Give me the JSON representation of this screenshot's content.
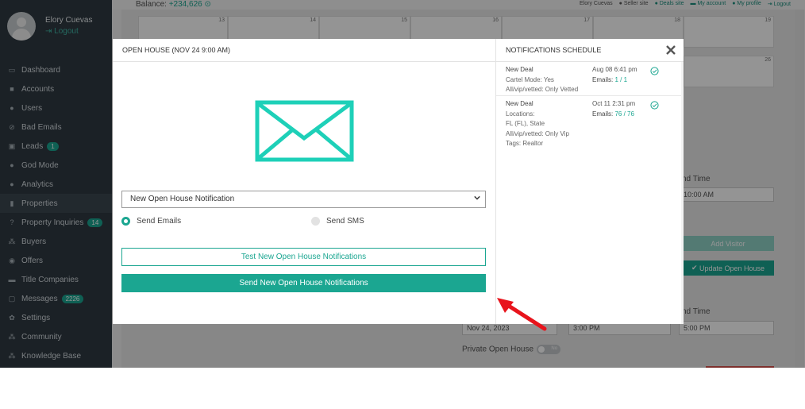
{
  "user": {
    "name": "Elory Cuevas",
    "logout": "Logout"
  },
  "sidebar": {
    "items": [
      {
        "label": "Dashboard",
        "icon": "dashboard-icon",
        "glyph": "▭"
      },
      {
        "label": "Accounts",
        "icon": "briefcase-icon",
        "glyph": "■"
      },
      {
        "label": "Users",
        "icon": "user-icon",
        "glyph": "●"
      },
      {
        "label": "Bad Emails",
        "icon": "ban-icon",
        "glyph": "⊘"
      },
      {
        "label": "Leads",
        "icon": "leads-icon",
        "glyph": "▣",
        "badge": "1"
      },
      {
        "label": "God Mode",
        "icon": "globe-icon",
        "glyph": "●"
      },
      {
        "label": "Analytics",
        "icon": "globe-icon",
        "glyph": "●"
      },
      {
        "label": "Properties",
        "icon": "building-icon",
        "glyph": "▮",
        "active": true
      },
      {
        "label": "Property Inquiries",
        "icon": "question-icon",
        "glyph": "?",
        "badge": "14"
      },
      {
        "label": "Buyers",
        "icon": "buyers-icon",
        "glyph": "⁂"
      },
      {
        "label": "Offers",
        "icon": "offers-icon",
        "glyph": "◉"
      },
      {
        "label": "Title Companies",
        "icon": "list-icon",
        "glyph": "▬"
      },
      {
        "label": "Messages",
        "icon": "message-icon",
        "glyph": "▢",
        "badge": "2226"
      },
      {
        "label": "Settings",
        "icon": "gear-icon",
        "glyph": "✿"
      },
      {
        "label": "Community",
        "icon": "community-icon",
        "glyph": "⁂"
      },
      {
        "label": "Knowledge Base",
        "icon": "book-icon",
        "glyph": "⁂"
      }
    ]
  },
  "topbar": {
    "balance_label": "Balance:",
    "balance_value": "+234,626",
    "links": [
      "Elory Cuevas",
      "Seller site",
      "Deals site",
      "My account",
      "My profile",
      "Logout"
    ]
  },
  "calendar": {
    "days": [
      "13",
      "14",
      "15",
      "16",
      "17",
      "18",
      "19",
      "26"
    ]
  },
  "background": {
    "end_time_label": "nd Time",
    "end_time_1": "10:00 AM",
    "add_visitor": "Add Visitor",
    "update_button": "Update Open House",
    "end_time_label_2": "nd Time",
    "date_value": "Nov 24, 2023",
    "start_value": "3:00 PM",
    "end_value": "5:00 PM",
    "private_label": "Private Open House",
    "toggle_text": "No"
  },
  "modal": {
    "title": "OPEN HOUSE (NOV 24 9:00 AM)",
    "select_value": "New Open House Notification",
    "send_emails": "Send Emails",
    "send_sms": "Send SMS",
    "test_button": "Test New Open House Notifications",
    "send_button": "Send New Open House Notifications",
    "accent": "#1ba691"
  },
  "schedule": {
    "title": "NOTIFICATIONS SCHEDULE",
    "entries": [
      {
        "lines": [
          "New Deal",
          "Cartel Mode: Yes",
          "All/vip/vetted: Only Vetted"
        ],
        "datetime": "Aug 08 6:41 pm",
        "emails_label": "Emails:",
        "emails_count": "1 / 1"
      },
      {
        "lines": [
          "New Deal",
          "Locations:",
          "FL (FL), State",
          "All/vip/vetted: Only Vip",
          "Tags: Realtor"
        ],
        "datetime": "Oct 11 2:31 pm",
        "emails_label": "Emails:",
        "emails_count": "76 / 76"
      }
    ]
  }
}
